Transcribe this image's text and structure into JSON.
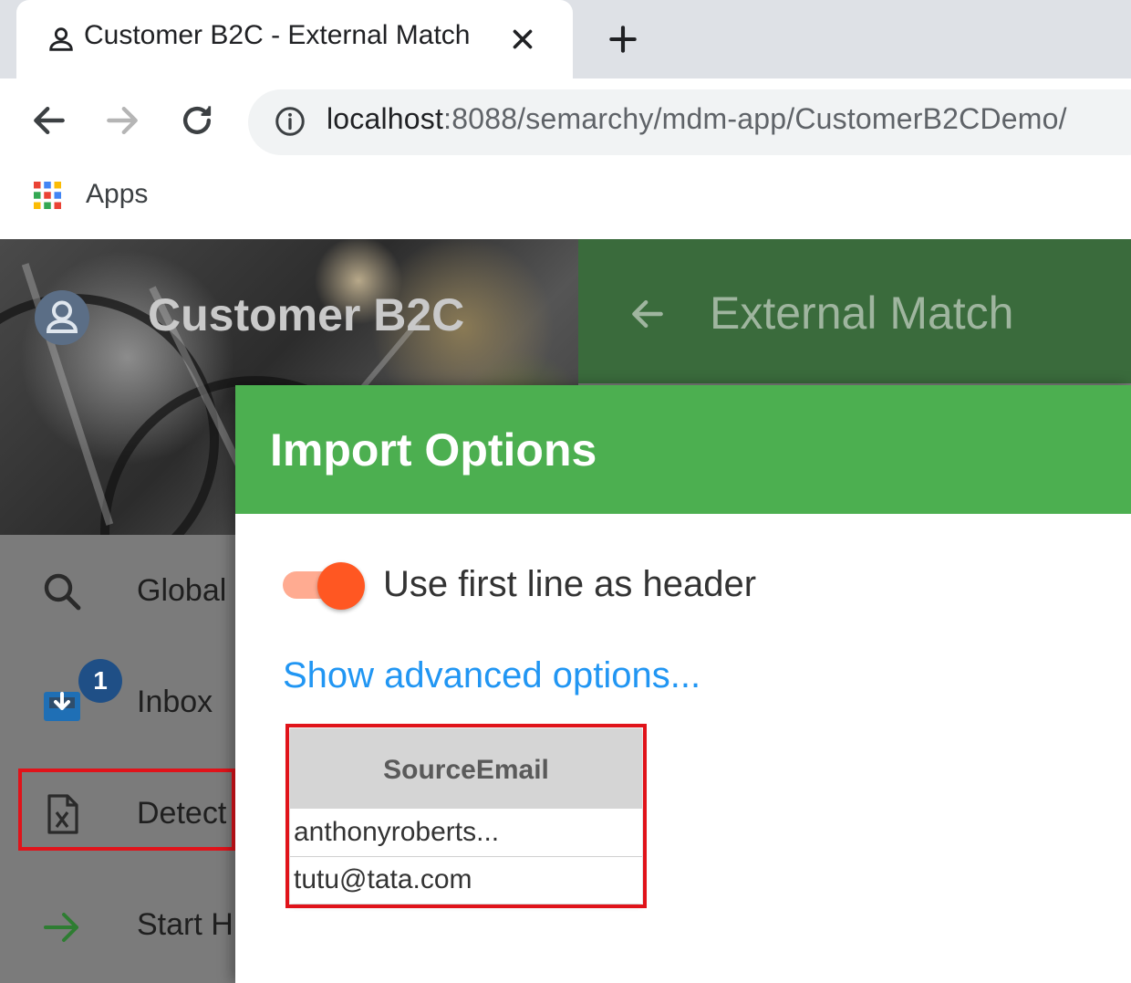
{
  "browser": {
    "tab_title": "Customer B2C - External Match",
    "url_host": "localhost",
    "url_rest": ":8088/semarchy/mdm-app/CustomerB2CDemo/",
    "bookmarks": {
      "apps_label": "Apps"
    }
  },
  "app": {
    "sidebar": {
      "title": "Customer B2C",
      "items": [
        {
          "label": "Global",
          "icon": "search-icon"
        },
        {
          "label": "Inbox",
          "icon": "inbox-icon",
          "badge": "1"
        },
        {
          "label": "Detect",
          "icon": "excel-file-icon"
        },
        {
          "label": "Start H",
          "icon": "arrow-right-icon"
        }
      ]
    },
    "page": {
      "title": "External Match",
      "back_icon": "back-arrow-icon"
    }
  },
  "dialog": {
    "title": "Import Options",
    "header_toggle": {
      "label": "Use first line as header",
      "checked": true
    },
    "advanced_link": "Show advanced options...",
    "preview": {
      "column_header": "SourceEmail",
      "rows": [
        "anthonyroberts...",
        "tutu@tata.com"
      ]
    }
  },
  "colors": {
    "dialog_header": "#4caf50",
    "page_header": "#3a6b3c",
    "toggle_on": "#ff5722",
    "link": "#2196f3",
    "highlight_box": "#e0131a",
    "badge": "#1f4f86"
  }
}
